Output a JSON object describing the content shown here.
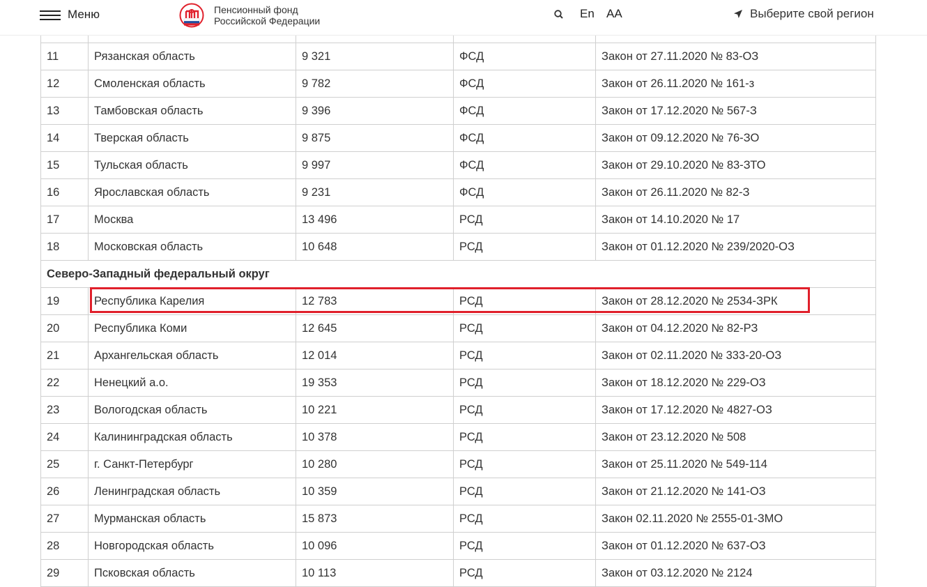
{
  "header": {
    "menu_label": "Меню",
    "logo_line1": "Пенсионный фонд",
    "logo_line2": "Российской Федерации",
    "lang_label": "En",
    "font_size_label": "АА",
    "region_label": "Выберите свой регион",
    "icons": {
      "menu": "hamburger-menu-icon",
      "logo": "pfr-logo",
      "search": "search-icon",
      "region": "location-arrow-icon"
    }
  },
  "table": {
    "partial_row": {
      "num": "",
      "region": "",
      "amount": "",
      "type": "",
      "law": ""
    },
    "rows_before": [
      {
        "num": "11",
        "region": "Рязанская область",
        "amount": "9 321",
        "type": "ФСД",
        "law": "Закон от 27.11.2020 № 83-ОЗ"
      },
      {
        "num": "12",
        "region": "Смоленская область",
        "amount": "9 782",
        "type": "ФСД",
        "law": "Закон от 26.11.2020 № 161-з"
      },
      {
        "num": "13",
        "region": "Тамбовская область",
        "amount": "9 396",
        "type": "ФСД",
        "law": "Закон от 17.12.2020 № 567-З"
      },
      {
        "num": "14",
        "region": "Тверская область",
        "amount": "9 875",
        "type": "ФСД",
        "law": "Закон от 09.12.2020 № 76-ЗО"
      },
      {
        "num": "15",
        "region": "Тульская область",
        "amount": "9 997",
        "type": "ФСД",
        "law": "Закон от 29.10.2020 № 83-ЗТО"
      },
      {
        "num": "16",
        "region": "Ярославская область",
        "amount": "9 231",
        "type": "ФСД",
        "law": "Закон от 26.11.2020 № 82-З"
      },
      {
        "num": "17",
        "region": "Москва",
        "amount": "13 496",
        "type": "РСД",
        "law": "Закон от 14.10.2020 № 17"
      },
      {
        "num": "18",
        "region": "Московская область",
        "amount": "10 648",
        "type": "РСД",
        "law": "Закон от 01.12.2020 № 239/2020-ОЗ"
      }
    ],
    "section_title": "Северо-Западный федеральный округ",
    "rows_after": [
      {
        "num": "19",
        "region": "Республика Карелия",
        "amount": "12 783",
        "type": "РСД",
        "law": "Закон от 28.12.2020 № 2534-ЗРК"
      },
      {
        "num": "20",
        "region": "Республика Коми",
        "amount": "12 645",
        "type": "РСД",
        "law": "Закон от 04.12.2020 № 82-РЗ"
      },
      {
        "num": "21",
        "region": "Архангельская область",
        "amount": "12 014",
        "type": "РСД",
        "law": "Закон от 02.11.2020 № 333-20-ОЗ"
      },
      {
        "num": "22",
        "region": "Ненецкий а.о.",
        "amount": "19 353",
        "type": "РСД",
        "law": "Закон от 18.12.2020 № 229-ОЗ"
      },
      {
        "num": "23",
        "region": "Вологодская область",
        "amount": "10 221",
        "type": "РСД",
        "law": "Закон от 17.12.2020 № 4827-ОЗ"
      },
      {
        "num": "24",
        "region": "Калининградская область",
        "amount": "10 378",
        "type": "РСД",
        "law": "Закон от 23.12.2020 № 508"
      },
      {
        "num": "25",
        "region": "г. Санкт-Петербург",
        "amount": "10 280",
        "type": "РСД",
        "law": " Закон от   25.11.2020 № 549-114"
      },
      {
        "num": "26",
        "region": "Ленинградская область",
        "amount": "10 359",
        "type": "РСД",
        "law": "Закон от 21.12.2020 № 141-ОЗ"
      },
      {
        "num": "27",
        "region": "Мурманская область",
        "amount": "15 873",
        "type": "РСД",
        "law": "Закон 02.11.2020 № 2555-01-ЗМО"
      },
      {
        "num": "28",
        "region": "Новгородская область",
        "amount": "10 096",
        "type": " РСД",
        "law": "Закон от 01.12.2020 № 637-ОЗ"
      },
      {
        "num": "29",
        "region": "Псковская область",
        "amount": "10 113",
        "type": "РСД",
        "law": "Закон от 03.12.2020 № 2124"
      }
    ],
    "highlight_color": "#e0202b"
  }
}
